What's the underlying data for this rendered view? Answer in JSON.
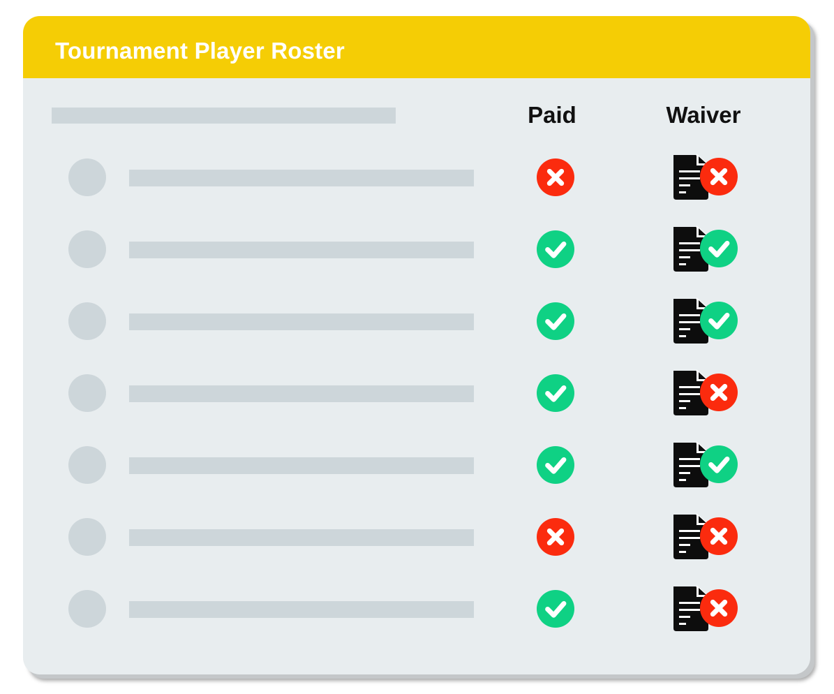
{
  "header": {
    "title": "Tournament Player Roster"
  },
  "columns": {
    "paid": "Paid",
    "waiver": "Waiver"
  },
  "colors": {
    "header_bg": "#f5cd05",
    "card_bg": "#e8edef",
    "placeholder": "#cdd6da",
    "status_ok": "#0fd184",
    "status_missing": "#fb2b0e"
  },
  "rows": [
    {
      "paid": "missing",
      "waiver": "missing"
    },
    {
      "paid": "ok",
      "waiver": "ok"
    },
    {
      "paid": "ok",
      "waiver": "ok"
    },
    {
      "paid": "ok",
      "waiver": "missing"
    },
    {
      "paid": "ok",
      "waiver": "ok"
    },
    {
      "paid": "missing",
      "waiver": "missing"
    },
    {
      "paid": "ok",
      "waiver": "missing"
    }
  ]
}
